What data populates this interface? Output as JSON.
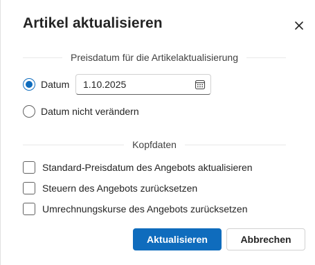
{
  "dialog": {
    "title": "Artikel aktualisieren",
    "close_icon": "close-icon"
  },
  "price_section": {
    "header": "Preisdatum für die Artikelaktualisierung",
    "radio_date": {
      "label": "Datum",
      "checked": true
    },
    "date_field": {
      "value": "1.10.2025",
      "icon": "calendar-icon"
    },
    "radio_keep": {
      "label": "Datum nicht verändern",
      "checked": false
    }
  },
  "header_section": {
    "header": "Kopfdaten",
    "checkboxes": [
      {
        "label": "Standard-Preisdatum des Angebots aktualisieren",
        "checked": false
      },
      {
        "label": "Steuern des Angebots zurücksetzen",
        "checked": false
      },
      {
        "label": "Umrechnungskurse des Angebots zurücksetzen",
        "checked": false
      }
    ]
  },
  "buttons": {
    "primary": "Aktualisieren",
    "secondary": "Abbrechen"
  },
  "colors": {
    "accent": "#0f6cbd",
    "text": "#242424",
    "border": "#d1d1d1"
  }
}
